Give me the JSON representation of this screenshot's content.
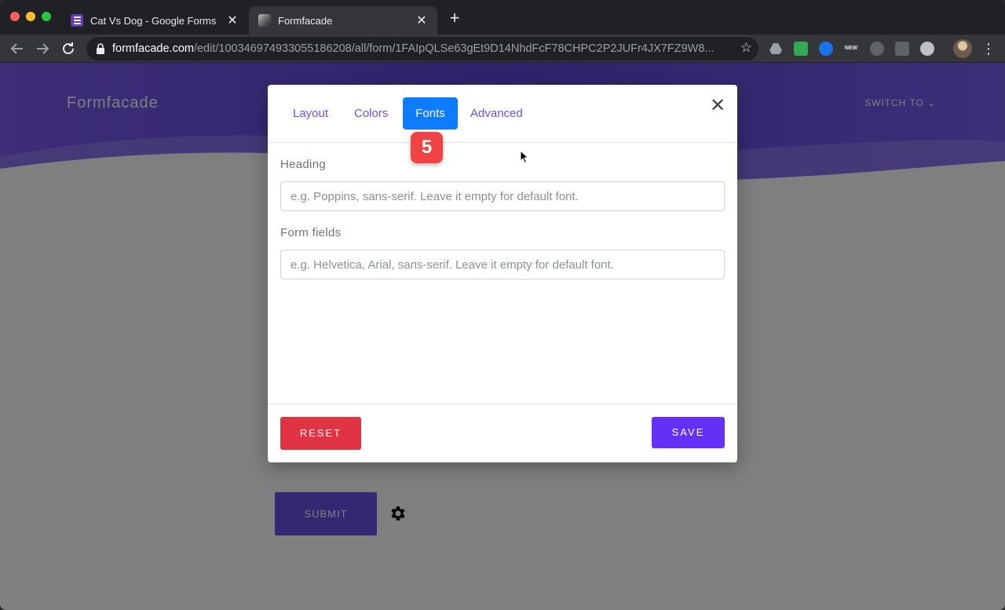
{
  "browser": {
    "tabs": [
      {
        "title": "Cat Vs Dog - Google Forms",
        "active": false
      },
      {
        "title": "Formfacade",
        "active": true
      }
    ],
    "new_tab_symbol": "+",
    "close_symbol": "✕",
    "url": {
      "domain": "formfacade.com",
      "path": "/edit/100346974933055186208/all/form/1FAIpQLSe63gEt9D14NhdFcF78CHPC2P2JUFr4JX7FZ9W8..."
    },
    "extension_new_label": "NEW"
  },
  "page": {
    "brand": "Formfacade",
    "switch_to": "SWITCH TO",
    "submit_label": "SUBMIT"
  },
  "modal": {
    "tabs": [
      {
        "label": "Layout"
      },
      {
        "label": "Colors"
      },
      {
        "label": "Fonts",
        "active": true
      },
      {
        "label": "Advanced"
      }
    ],
    "close_symbol": "✕",
    "step_badge": "5",
    "heading_label": "Heading",
    "heading_placeholder": "e.g. Poppins, sans-serif. Leave it empty for default font.",
    "heading_value": "",
    "fields_label": "Form fields",
    "fields_placeholder": "e.g. Helvetica, Arial, sans-serif. Leave it empty for default font.",
    "fields_value": "",
    "reset_label": "RESET",
    "save_label": "SAVE"
  },
  "colors": {
    "accent": "#6c4ee6",
    "active_tab": "#0d7cff",
    "reset": "#e03444",
    "save": "#6430f6",
    "badge": "#f04343"
  }
}
